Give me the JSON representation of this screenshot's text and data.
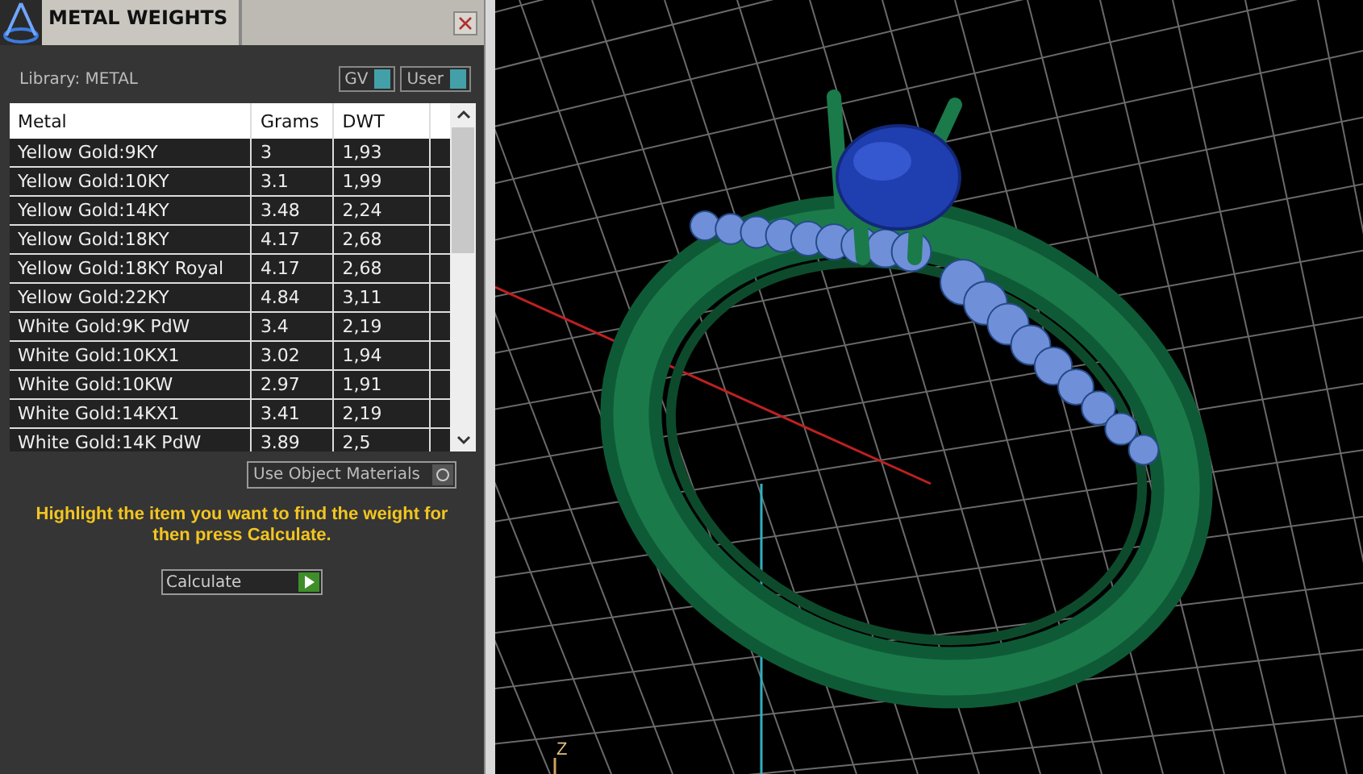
{
  "panel": {
    "title": "METAL WEIGHTS",
    "library": "Library: METAL",
    "toggles": [
      {
        "label": "GV",
        "on": true
      },
      {
        "label": "User",
        "on": true
      }
    ],
    "table": {
      "columns": [
        "Metal",
        "Grams",
        "DWT"
      ],
      "rows": [
        [
          "Yellow Gold:9KY",
          "3",
          "1,93"
        ],
        [
          "Yellow Gold:10KY",
          "3.1",
          "1,99"
        ],
        [
          "Yellow Gold:14KY",
          "3.48",
          "2,24"
        ],
        [
          "Yellow Gold:18KY",
          "4.17",
          "2,68"
        ],
        [
          "Yellow Gold:18KY Royal",
          "4.17",
          "2,68"
        ],
        [
          "Yellow Gold:22KY",
          "4.84",
          "3,11"
        ],
        [
          "White Gold:9K PdW",
          "3.4",
          "2,19"
        ],
        [
          "White Gold:10KX1",
          "3.02",
          "1,94"
        ],
        [
          "White Gold:10KW",
          "2.97",
          "1,91"
        ],
        [
          "White Gold:14KX1",
          "3.41",
          "2,19"
        ],
        [
          "White Gold:14K PdW",
          "3.89",
          "2,5"
        ]
      ]
    },
    "object_materials": {
      "label": "Use Object Materials",
      "on": false
    },
    "hint": "Highlight the item you want to find the weight for then press Calculate.",
    "calculate": {
      "label": "Calculate"
    }
  },
  "viewport": {
    "axis_label": "Z"
  }
}
